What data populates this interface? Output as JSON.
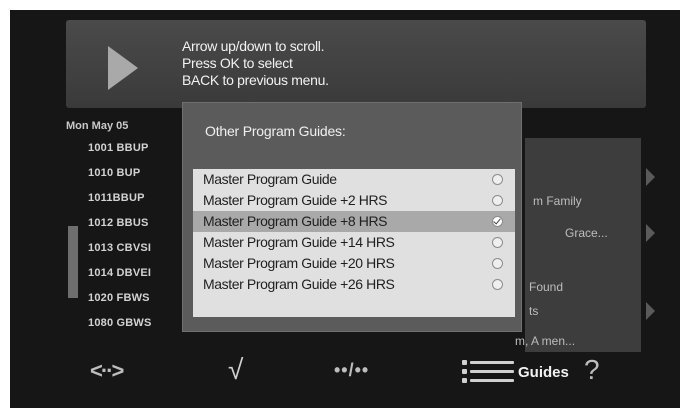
{
  "help": {
    "lines": [
      "Arrow up/down to scroll.",
      "Press OK to select",
      "BACK to previous menu."
    ]
  },
  "guide": {
    "date": "Mon May 05",
    "channels": [
      "1001 BBUP",
      "1010 BUP",
      "1011BBUP",
      "1012 BBUS",
      "1013 CBVSI",
      "1014 DBVEI",
      "1020 FBWS",
      "1080 GBWS"
    ],
    "right_rows": [
      "m Family",
      "Grace...",
      "Found",
      "ts",
      "m, A men..."
    ],
    "bottom_strip": "...                                   ...  ...  ...  ..."
  },
  "popup": {
    "title": "Other Program Guides:",
    "options": [
      {
        "label": "Master Program Guide",
        "checked": false
      },
      {
        "label": "Master Program Guide +2 HRS",
        "checked": false
      },
      {
        "label": "Master Program Guide +8 HRS",
        "checked": true
      },
      {
        "label": "Master Program Guide +14 HRS",
        "checked": false
      },
      {
        "label": "Master Program Guide +20 HRS",
        "checked": false
      },
      {
        "label": "Master Program Guide +26 HRS",
        "checked": false
      }
    ],
    "selected_index": 2
  },
  "controls": {
    "nav_glyph": "<··>",
    "check_glyph": "√",
    "page_glyph": "••/••",
    "guides_label": "Guides",
    "help_glyph": "?"
  },
  "colors": {
    "screen_bg": "#161616",
    "popup_bg": "#5b5b5b",
    "list_bg": "#e0e0e0",
    "selected_row": "#a9a9a9"
  }
}
